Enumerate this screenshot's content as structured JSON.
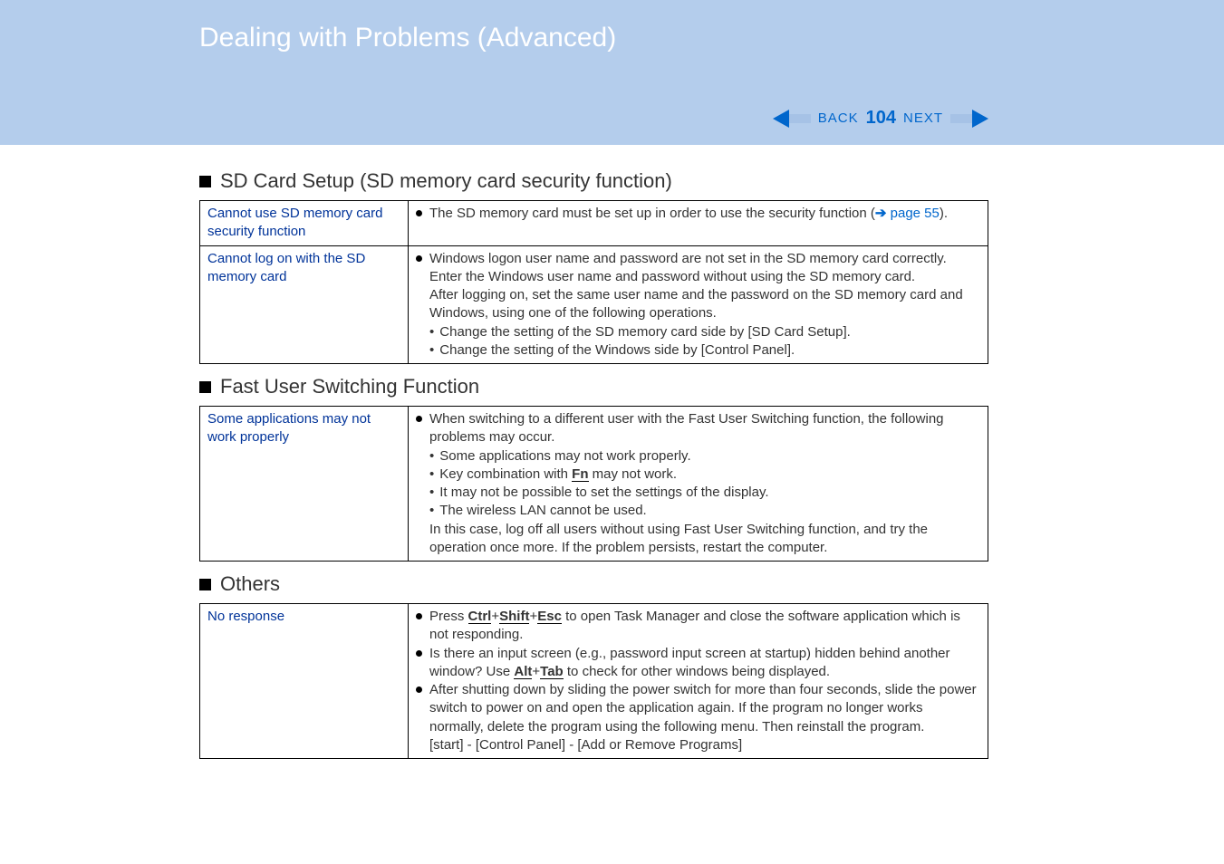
{
  "header": {
    "title": "Dealing with Problems (Advanced)"
  },
  "nav": {
    "back": "BACK",
    "page": "104",
    "next": "NEXT"
  },
  "section1": {
    "title": "SD Card Setup (SD memory card security function)",
    "rows": [
      {
        "problem": "Cannot use SD memory card security function",
        "sol": {
          "b1": "The SD memory card must be set up in order to use the security function (",
          "link": "page 55",
          "b1_end": ")."
        }
      },
      {
        "problem": "Cannot log on with the SD memory card",
        "sol": {
          "b1": "Windows logon user name and password are not set in the SD memory card correctly.",
          "b1_l2": "Enter the Windows user name and password without using the SD memory card.",
          "b1_l3": "After logging on, set the same user name and the password on the SD memory card and Windows, using one of the following operations.",
          "sb1": "Change the setting of the SD memory card side by [SD Card Setup].",
          "sb2": "Change the setting of the Windows side by [Control Panel]."
        }
      }
    ]
  },
  "section2": {
    "title": "Fast User Switching Function",
    "rows": [
      {
        "problem": "Some applications may not work properly",
        "sol": {
          "b1": "When switching to a different user with the Fast User Switching function, the following problems may occur.",
          "sb1": "Some applications may not work properly.",
          "sb2_pre": "Key combination with ",
          "sb2_key": "Fn",
          "sb2_post": " may not work.",
          "sb3": "It may not be possible to set the settings of the display.",
          "sb4": "The wireless LAN cannot be used.",
          "b1_after": "In this case, log off all users without using Fast User Switching function, and try the operation once more. If the problem persists, restart the computer."
        }
      }
    ]
  },
  "section3": {
    "title": "Others",
    "rows": [
      {
        "problem": "No response",
        "sol": {
          "b1_pre": "Press ",
          "k1": "Ctrl",
          "plus1": "+",
          "k2": "Shift",
          "plus2": "+",
          "k3": "Esc",
          "b1_post": " to open Task Manager and close the software application which is not responding.",
          "b2_pre": "Is there an input screen (e.g., password input screen at startup) hidden behind another window?  Use ",
          "k4": "Alt",
          "plus3": "+",
          "k5": "Tab",
          "b2_post": " to check for other windows being displayed.",
          "b3": "After shutting down by sliding the power switch for more than four seconds, slide the power switch to power on and open the application again. If the program no longer works normally, delete the program using the following menu.  Then reinstall the program.",
          "b3_l2": "[start] - [Control Panel] - [Add or Remove Programs]"
        }
      }
    ]
  }
}
